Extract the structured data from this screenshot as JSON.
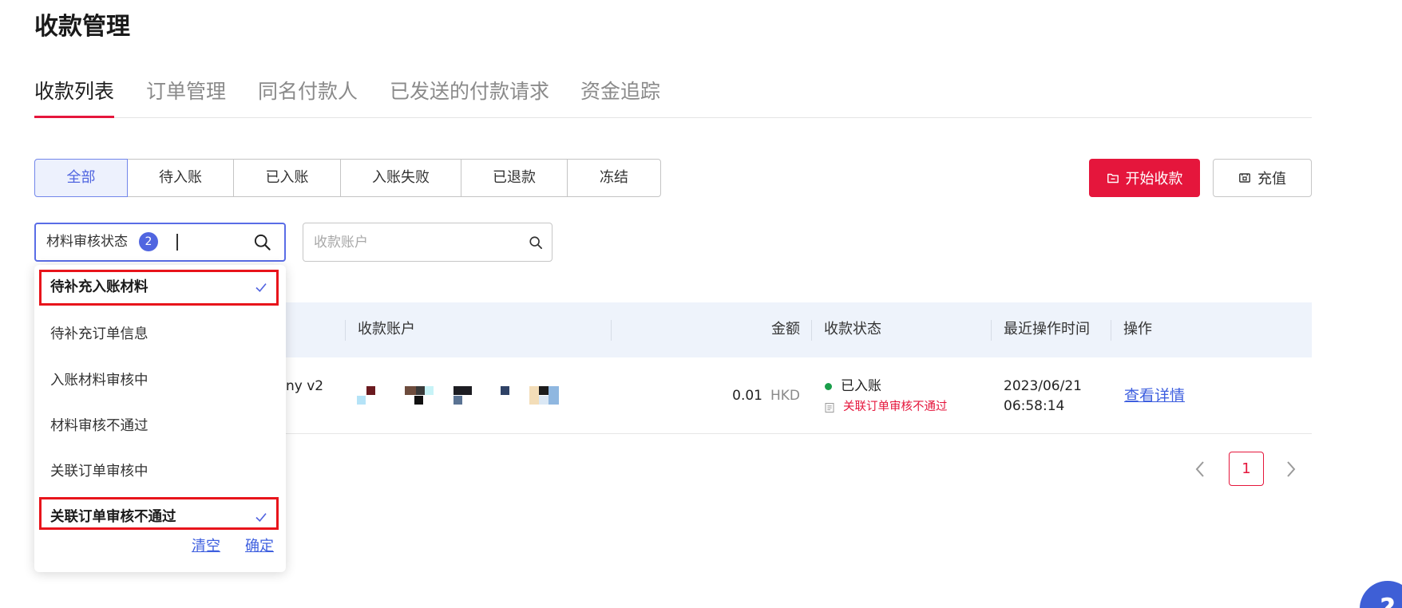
{
  "page": {
    "title": "收款管理"
  },
  "tabs": [
    {
      "label": "收款列表",
      "active": true
    },
    {
      "label": "订单管理",
      "active": false
    },
    {
      "label": "同名付款人",
      "active": false
    },
    {
      "label": "已发送的付款请求",
      "active": false
    },
    {
      "label": "资金追踪",
      "active": false
    }
  ],
  "status_filters": [
    {
      "label": "全部",
      "selected": true
    },
    {
      "label": "待入账",
      "selected": false
    },
    {
      "label": "已入账",
      "selected": false
    },
    {
      "label": "入账失败",
      "selected": false
    },
    {
      "label": "已退款",
      "selected": false
    },
    {
      "label": "冻结",
      "selected": false
    }
  ],
  "actions": {
    "start_collect": {
      "label": "开始收款",
      "icon": "folder-icon"
    },
    "recharge": {
      "label": "充值",
      "icon": "recharge-icon"
    }
  },
  "filters": {
    "material_status": {
      "label": "材料审核状态",
      "selected_count": "2",
      "icon": "search-icon"
    },
    "account": {
      "placeholder": "收款账户",
      "value": "",
      "icon": "search-icon"
    }
  },
  "dropdown": {
    "options": [
      {
        "label": "待补充入账材料",
        "selected": true
      },
      {
        "label": "待补充订单信息",
        "selected": false
      },
      {
        "label": "入账材料审核中",
        "selected": false
      },
      {
        "label": "材料审核不通过",
        "selected": false
      },
      {
        "label": "关联订单审核中",
        "selected": false
      },
      {
        "label": "关联订单审核不通过",
        "selected": true
      }
    ],
    "check_icon": "check-icon",
    "clear": "清空",
    "confirm": "确定"
  },
  "table": {
    "columns": {
      "account": "收款账户",
      "amount": "金额",
      "status": "收款状态",
      "updated": "最近操作时间",
      "action": "操作"
    },
    "rows": [
      {
        "name": "ny v2",
        "account_redacted": true,
        "amount": "0.01",
        "currency": "HKD",
        "status": "已入账",
        "note_icon": "document-icon",
        "note": "关联订单审核不通过",
        "date": "2023/06/21",
        "time": "06:58:14",
        "action": "查看详情"
      }
    ]
  },
  "pagination": {
    "current": "1",
    "prev_icon": "chevron-left-icon",
    "next_icon": "chevron-right-icon"
  },
  "help": {
    "label": "?"
  },
  "colors": {
    "brand_red": "#e5163c",
    "accent_blue": "#5065e0",
    "link_blue": "#3e5fdf",
    "status_green": "#1a9e4a",
    "table_header_bg": "#eef3fb",
    "annotation_red": "#e8141b"
  }
}
